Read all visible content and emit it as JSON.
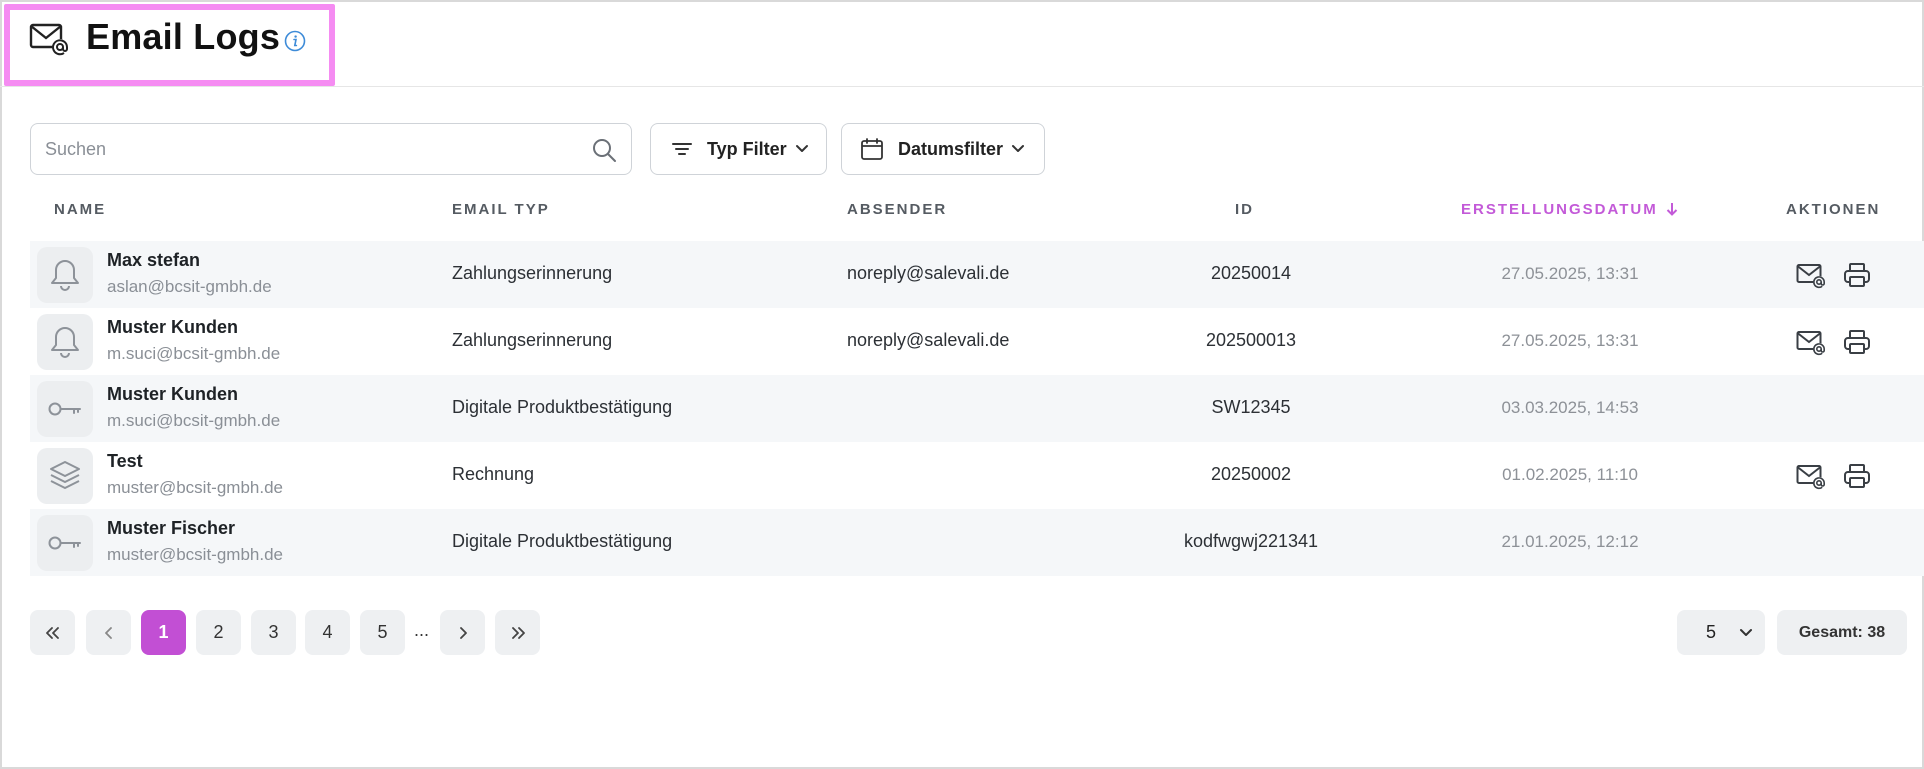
{
  "header": {
    "title": "Email Logs"
  },
  "search": {
    "placeholder": "Suchen",
    "value": ""
  },
  "filters": {
    "type_label": "Typ Filter",
    "date_label": "Datumsfilter"
  },
  "table": {
    "columns": {
      "name": "NAME",
      "email_type": "EMAIL TYP",
      "sender": "ABSENDER",
      "id": "ID",
      "created": "ERSTELLUNGSDATUM",
      "actions": "AKTIONEN"
    },
    "sort": {
      "column": "created",
      "direction": "desc",
      "accent_color": "#c35ad8"
    },
    "rows": [
      {
        "icon": "bell-icon",
        "name": "Max stefan",
        "email": "aslan@bcsit-gmbh.de",
        "email_type": "Zahlungserinnerung",
        "sender": "noreply@salevali.de",
        "id": "20250014",
        "created": "27.05.2025, 13:31",
        "actions": [
          "resend-email-icon",
          "print-icon"
        ]
      },
      {
        "icon": "bell-icon",
        "name": "Muster Kunden",
        "email": "m.suci@bcsit-gmbh.de",
        "email_type": "Zahlungserinnerung",
        "sender": "noreply@salevali.de",
        "id": "202500013",
        "created": "27.05.2025, 13:31",
        "actions": [
          "resend-email-icon",
          "print-icon"
        ]
      },
      {
        "icon": "key-icon",
        "name": "Muster Kunden",
        "email": "m.suci@bcsit-gmbh.de",
        "email_type": "Digitale Produktbestätigung",
        "sender": "",
        "id": "SW12345",
        "created": "03.03.2025, 14:53",
        "actions": []
      },
      {
        "icon": "layers-icon",
        "name": "Test",
        "email": "muster@bcsit-gmbh.de",
        "email_type": "Rechnung",
        "sender": "",
        "id": "20250002",
        "created": "01.02.2025, 11:10",
        "actions": [
          "resend-email-icon",
          "print-icon"
        ]
      },
      {
        "icon": "key-icon",
        "name": "Muster Fischer",
        "email": "muster@bcsit-gmbh.de",
        "email_type": "Digitale Produktbestätigung",
        "sender": "",
        "id": "kodfwgwj221341",
        "created": "21.01.2025, 12:12",
        "actions": []
      }
    ]
  },
  "pagination": {
    "pages": [
      "1",
      "2",
      "3",
      "4",
      "5"
    ],
    "current": "1",
    "ellipsis": "...",
    "page_size": "5",
    "total": "Gesamt: 38",
    "active_color": "#c24fd4"
  }
}
